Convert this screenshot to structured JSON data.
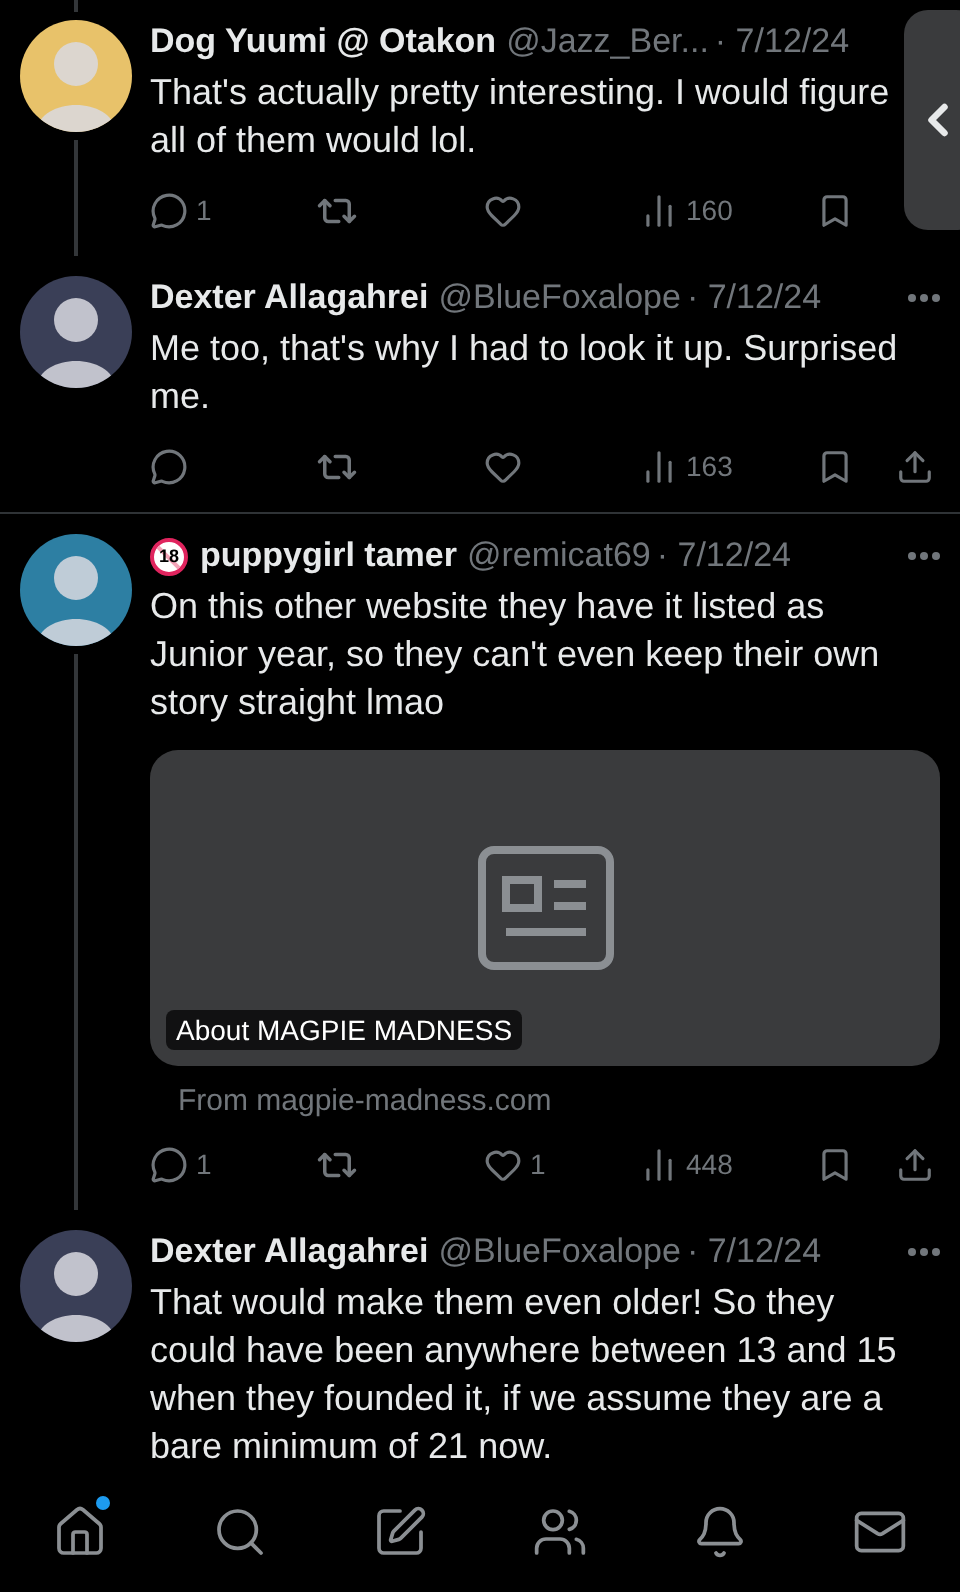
{
  "tweets": [
    {
      "name": "Dog Yuumi @ Otakon",
      "handle": "@Jazz_Ber...",
      "date": "· 7/12/24",
      "text": "That's actually pretty interesting. I would figure all of them would lol.",
      "thread_above": true,
      "thread_below": true,
      "more_button": false,
      "share_button": false,
      "replies": "1",
      "views": "160"
    },
    {
      "name": "Dexter Allagahrei",
      "handle": "@BlueFoxalope",
      "date": "· 7/12/24",
      "text": "Me too, that's why I had to look it up. Surprised me.",
      "thread_above": false,
      "thread_below": false,
      "more_button": true,
      "share_button": true,
      "views": "163"
    },
    {
      "name": "puppygirl tamer",
      "badge": "18",
      "handle": "@remicat69",
      "date": "· 7/12/24",
      "text": "On this other website they have it listed as Junior year, so they can't even keep their own story straight lmao",
      "thread_above": false,
      "thread_below": true,
      "more_button": true,
      "share_button": true,
      "card": {
        "title": "About MAGPIE MADNESS",
        "source": "From magpie-madness.com"
      },
      "replies": "1",
      "likes": "1",
      "views": "448"
    },
    {
      "name": "Dexter Allagahrei",
      "handle": "@BlueFoxalope",
      "date": "· 7/12/24",
      "text": "That would make them even older! So they could have been anywhere between 13 and 15 when they founded it, if we assume they are a bare minimum of 21 now.",
      "thread_above": false,
      "thread_below": false,
      "more_button": true,
      "share_button": false
    }
  ],
  "nav": [
    {
      "kind": "home",
      "unread": true
    },
    {
      "kind": "search",
      "unread": false
    },
    {
      "kind": "compose",
      "unread": false
    },
    {
      "kind": "people",
      "unread": false
    },
    {
      "kind": "notifications",
      "unread": false
    },
    {
      "kind": "messages",
      "unread": false
    }
  ]
}
